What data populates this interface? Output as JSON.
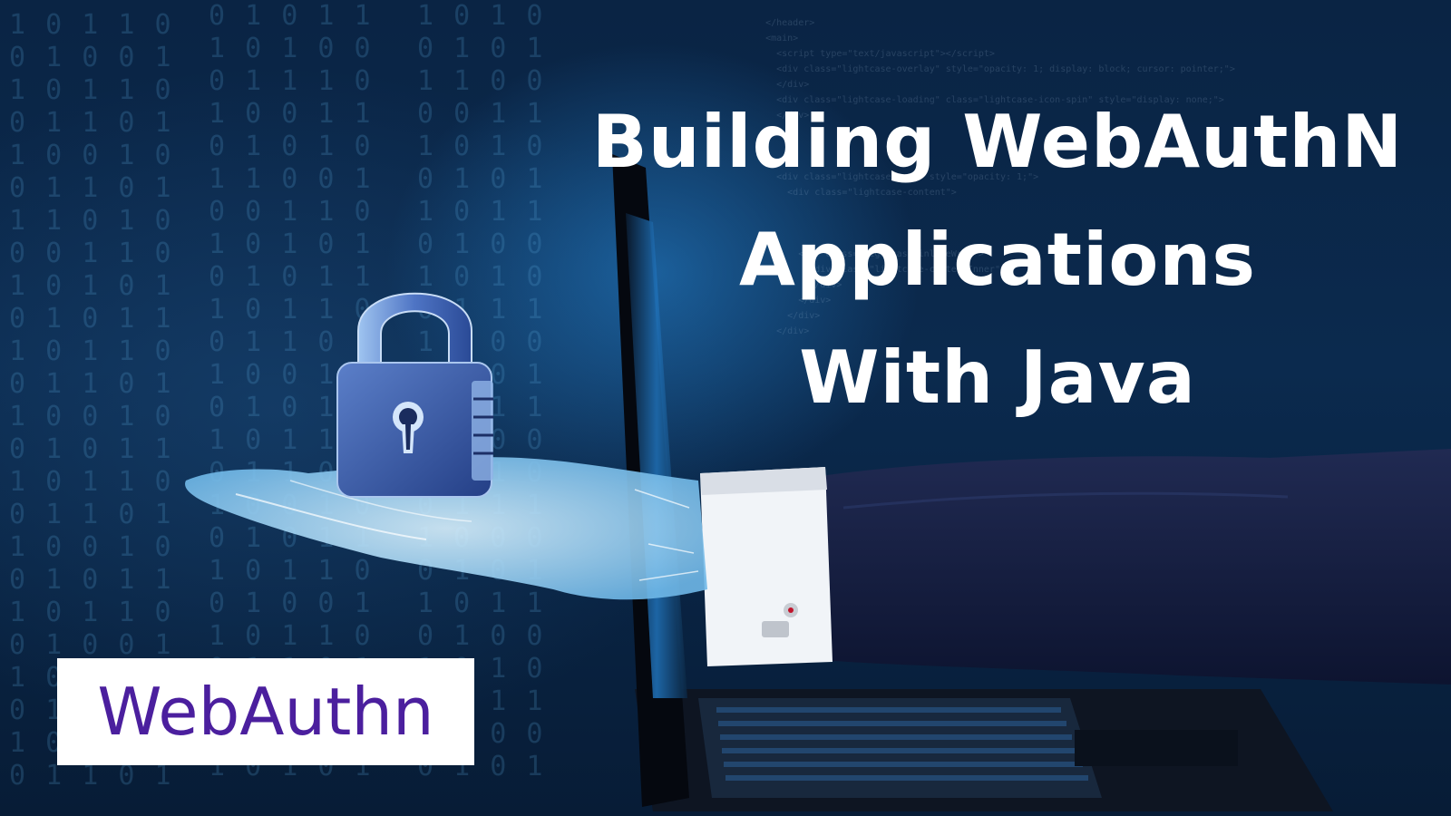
{
  "title": {
    "line1": "Building WebAuthN",
    "line2": "Applications",
    "line3": "With Java"
  },
  "logo": {
    "text": "WebAuthn",
    "color": "#4b1f9e"
  },
  "illustration": {
    "padlock": "padlock-icon",
    "laptop": "laptop",
    "arm": "business-arm",
    "hand": "holographic-hand"
  },
  "colors": {
    "background": "#0b2a4e",
    "glow": "#2e8fd8",
    "title_text": "#ffffff"
  }
}
